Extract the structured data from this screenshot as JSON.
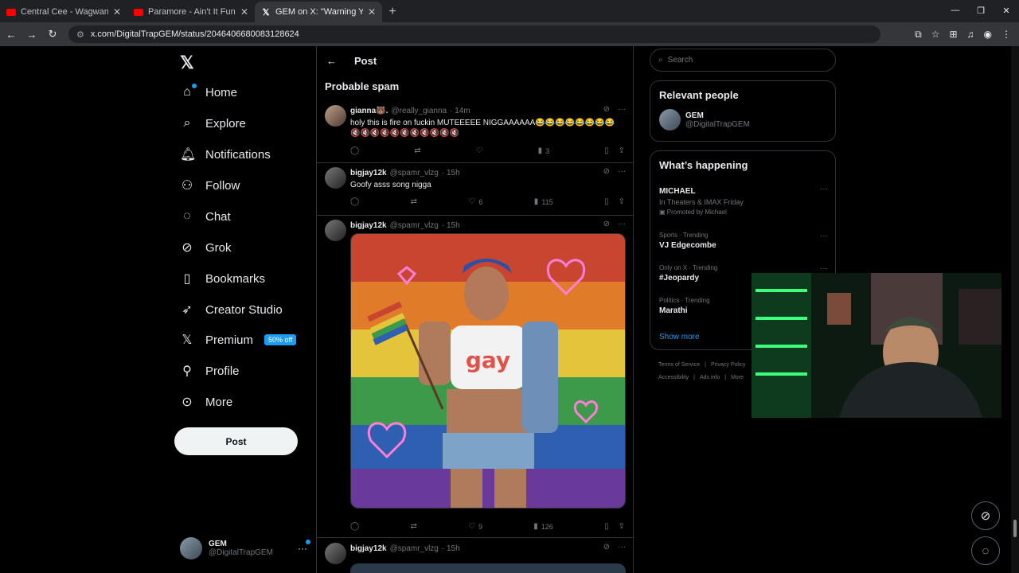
{
  "browser": {
    "tabs": [
      {
        "title": "Central Cee - Wagwan [ Instrum",
        "icon": "youtube-icon"
      },
      {
        "title": "Paramore - Ain't It Fun | Lyrics -",
        "icon": "youtube-icon"
      },
      {
        "title": "GEM on X: \"Warning Yonna Dis",
        "icon": "x-icon"
      }
    ],
    "url": "x.com/DigitalTrapGEM/status/2046406680083128624"
  },
  "nav": {
    "items": [
      {
        "label": "Home",
        "icon": "home-icon",
        "glyph": "⌂"
      },
      {
        "label": "Explore",
        "icon": "search-icon",
        "glyph": "⌕"
      },
      {
        "label": "Notifications",
        "icon": "bell-icon",
        "glyph": "♫"
      },
      {
        "label": "Follow",
        "icon": "person-plus-icon",
        "glyph": "⚇"
      },
      {
        "label": "Chat",
        "icon": "chat-icon",
        "glyph": "◌"
      },
      {
        "label": "Grok",
        "icon": "grok-icon",
        "glyph": "⊘"
      },
      {
        "label": "Bookmarks",
        "icon": "bookmark-icon",
        "glyph": "⛉"
      },
      {
        "label": "Creator Studio",
        "icon": "rocket-icon",
        "glyph": "➶"
      },
      {
        "label": "Premium",
        "icon": "x-icon",
        "glyph": "𝕏",
        "badge": "50% off"
      },
      {
        "label": "Profile",
        "icon": "person-icon",
        "glyph": "⚲"
      },
      {
        "label": "More",
        "icon": "more-circle-icon",
        "glyph": "⊙"
      }
    ],
    "post_button": "Post",
    "account": {
      "name": "GEM",
      "handle": "@DigitalTrapGEM"
    }
  },
  "main": {
    "header_title": "Post",
    "section_title": "Probable spam",
    "tweets": [
      {
        "name": "gianna🐻.",
        "handle": "@really_gianna",
        "time": "· 14m",
        "text": "holy this is fire on fuckin MUTEEEEE NIGGAAAAAA😂😂😂😂😂😂😂😂 🔇🔇🔇🔇🔇🔇🔇🔇🔇🔇🔇",
        "views": "3",
        "likes": "",
        "retweets": "",
        "replies": ""
      },
      {
        "name": "bigjay12k",
        "handle": "@spamr_vlzg",
        "time": "· 15h",
        "text": "Goofy asss song nigga",
        "likes": "6",
        "views": "115"
      },
      {
        "name": "bigjay12k",
        "handle": "@spamr_vlzg",
        "time": "· 15h",
        "media_text": "gay",
        "likes": "9",
        "views": "126"
      },
      {
        "name": "bigjay12k",
        "handle": "@spamr_vlzg",
        "time": "· 15h"
      }
    ]
  },
  "sidebar": {
    "search_placeholder": "Search",
    "relevant_title": "Relevant people",
    "relevant": {
      "name": "GEM",
      "handle": "@DigitalTrapGEM"
    },
    "happening_title": "What’s happening",
    "trends": [
      {
        "context": "",
        "title": "MICHAEL",
        "sub": "In Theaters & IMAX Friday",
        "promo": "Promoted by Michael"
      },
      {
        "context": "Sports · Trending",
        "title": "VJ Edgecombe"
      },
      {
        "context": "Only on X · Trending",
        "title": "#Jeopardy"
      },
      {
        "context": "Politics · Trending",
        "title": "Marathi"
      }
    ],
    "show_more": "Show more",
    "footer": [
      "Terms of Service",
      "|",
      "Privacy Policy",
      "Accessibility",
      "|",
      "Ads info",
      "|",
      "More"
    ]
  },
  "colors": {
    "accent": "#1d9bf0",
    "bg": "#000000",
    "border": "#2f3336",
    "muted": "#71767b"
  }
}
